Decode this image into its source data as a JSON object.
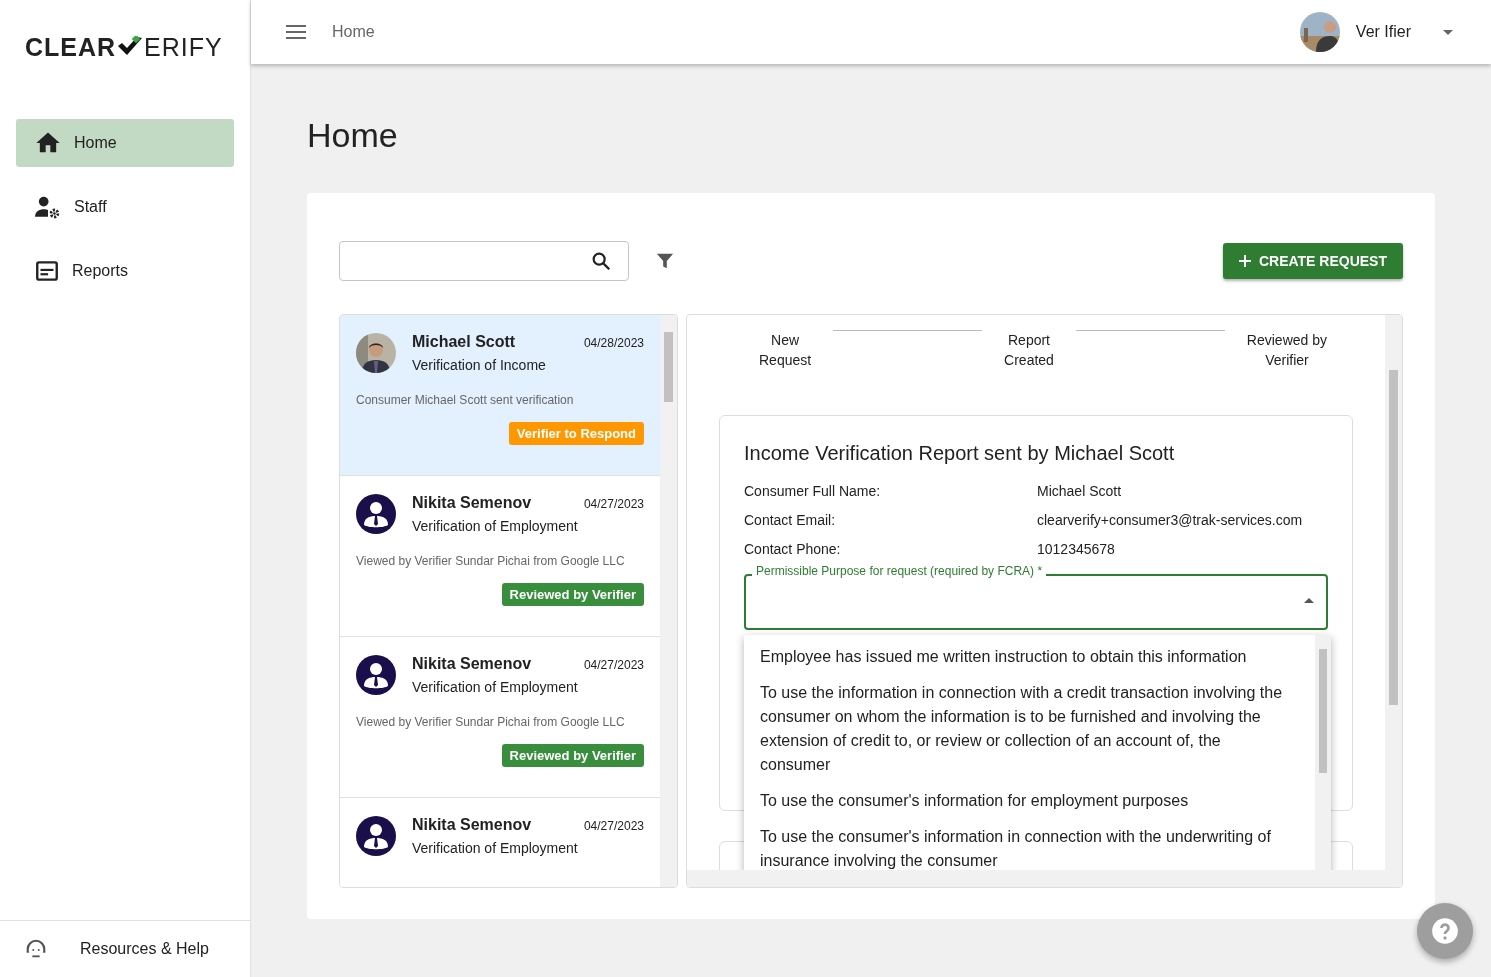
{
  "logo": {
    "left": "CLEAR",
    "right": "ERIFY"
  },
  "sidebar": {
    "items": [
      {
        "label": "Home",
        "kind": "home",
        "selected": true
      },
      {
        "label": "Staff",
        "kind": "staff",
        "selected": false
      },
      {
        "label": "Reports",
        "kind": "reports",
        "selected": false
      }
    ],
    "footer": "Resources & Help"
  },
  "topbar": {
    "breadcrumb": "Home",
    "user": "Ver Ifier"
  },
  "page_title": "Home",
  "toolbar": {
    "create_button": "CREATE REQUEST"
  },
  "requests": [
    {
      "name": "Michael Scott",
      "date": "04/28/2023",
      "type": "Verification of Income",
      "message": "Consumer Michael Scott sent verification",
      "status": "Verifier to Respond",
      "color": "#ff9800",
      "selected": true
    },
    {
      "name": "Nikita Semenov",
      "date": "04/27/2023",
      "type": "Verification of Employment",
      "kind": "icon",
      "message": "Viewed by Verifier Sundar Pichai from Google LLC",
      "status": "Reviewed by Verifier",
      "color": "#388e3c",
      "selected": false
    },
    {
      "name": "Nikita Semenov",
      "date": "04/27/2023",
      "type": "Verification of Employment",
      "kind": "icon",
      "message": "Viewed by Verifier Sundar Pichai from Google LLC",
      "status": "Reviewed by Verifier",
      "color": "#388e3c",
      "selected": false
    },
    {
      "name": "Nikita Semenov",
      "date": "04/27/2023",
      "type": "Verification of Employment",
      "kind": "icon",
      "selected": false
    }
  ],
  "steps": [
    {
      "line1": "New",
      "line2": "Request"
    },
    {
      "line1": "Report",
      "line2": "Created"
    },
    {
      "line1": "Reviewed by",
      "line2": "Verifier"
    }
  ],
  "report": {
    "title": "Income Verification Report sent by Michael Scott",
    "fields": [
      {
        "label": "Consumer Full Name:",
        "value": "Michael Scott"
      },
      {
        "label": "Contact Email:",
        "value": "clearverify+consumer3@trak-services.com"
      },
      {
        "label": "Contact Phone:",
        "value": "1012345678"
      }
    ],
    "purpose_select": {
      "label": "Permissible Purpose for request (required by FCRA) *",
      "expanded": true,
      "options": [
        "Employee has issued me written instruction to obtain this information",
        "To use the information in connection with a credit transaction involving the consumer on whom the information is to be furnished and involving the extension of credit to, or review or collection of an account of, the consumer",
        "To use the consumer's information for employment purposes",
        "To use the consumer's information in connection with the underwriting of insurance involving the consumer"
      ]
    }
  }
}
